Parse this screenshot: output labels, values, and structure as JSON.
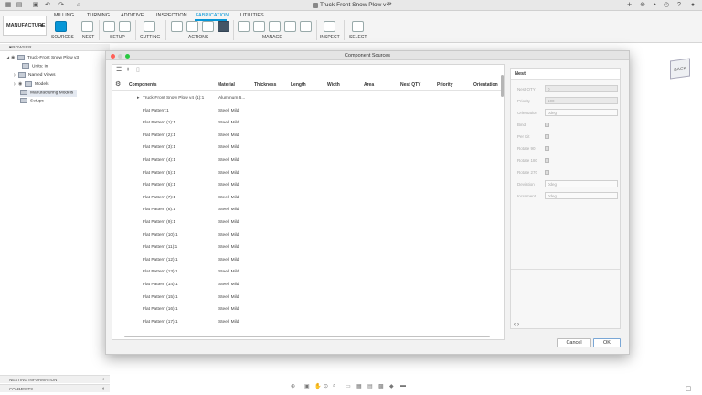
{
  "window": {
    "document_title": "Truck-Front Snow Plow v4*"
  },
  "ribbon": {
    "workspace": "MANUFACTURE",
    "tabs": [
      "MILLING",
      "TURNING",
      "ADDITIVE",
      "INSPECTION",
      "FABRICATION",
      "UTILITIES"
    ],
    "active_tab": "FABRICATION",
    "groups": [
      "SOURCES",
      "NEST",
      "SETUP",
      "CUTTING",
      "ACTIONS",
      "MANAGE",
      "INSPECT",
      "SELECT"
    ]
  },
  "browser": {
    "header": "BROWSER",
    "items": [
      {
        "label": "Truck-Front Snow Plow v3"
      },
      {
        "label": "Units: in"
      },
      {
        "label": "Named Views"
      },
      {
        "label": "Models"
      },
      {
        "label": "Manufacturing Models"
      },
      {
        "label": "Setups"
      }
    ]
  },
  "bottom_panels": {
    "nesting_information": "NESTING INFORMATION",
    "comments": "COMMENTS"
  },
  "viewcube": {
    "face": "BACK"
  },
  "dialog": {
    "title": "Component Sources",
    "columns": [
      "Components",
      "Material",
      "Thickness",
      "Length",
      "Width",
      "Area",
      "Nest QTY",
      "Priority",
      "Orientation"
    ],
    "rows": [
      {
        "component": "Truck-Front Snow Plow v4 (1):1",
        "material": "Aluminum 6..."
      },
      {
        "component": "Flat Pattern:1",
        "material": "Steel, Mild"
      },
      {
        "component": "Flat Pattern (1):1",
        "material": "Steel, Mild"
      },
      {
        "component": "Flat Pattern (2):1",
        "material": "Steel, Mild"
      },
      {
        "component": "Flat Pattern (3):1",
        "material": "Steel, Mild"
      },
      {
        "component": "Flat Pattern (4):1",
        "material": "Steel, Mild"
      },
      {
        "component": "Flat Pattern (5):1",
        "material": "Steel, Mild"
      },
      {
        "component": "Flat Pattern (6):1",
        "material": "Steel, Mild"
      },
      {
        "component": "Flat Pattern (7):1",
        "material": "Steel, Mild"
      },
      {
        "component": "Flat Pattern (8):1",
        "material": "Steel, Mild"
      },
      {
        "component": "Flat Pattern (9):1",
        "material": "Steel, Mild"
      },
      {
        "component": "Flat Pattern (10):1",
        "material": "Steel, Mild"
      },
      {
        "component": "Flat Pattern (11):1",
        "material": "Steel, Mild"
      },
      {
        "component": "Flat Pattern (12):1",
        "material": "Steel, Mild"
      },
      {
        "component": "Flat Pattern (13):1",
        "material": "Steel, Mild"
      },
      {
        "component": "Flat Pattern (14):1",
        "material": "Steel, Mild"
      },
      {
        "component": "Flat Pattern (15):1",
        "material": "Steel, Mild"
      },
      {
        "component": "Flat Pattern (16):1",
        "material": "Steel, Mild"
      },
      {
        "component": "Flat Pattern (17):1",
        "material": "Steel, Mild"
      }
    ],
    "props": {
      "header": "Nest",
      "nest_qty_label": "Nest QTY",
      "nest_qty_value": "0",
      "priority_label": "Priority",
      "priority_value": "100",
      "orientation_label": "Orientation",
      "orientation_value": "0deg",
      "bind_label": "Bind",
      "per_kit_label": "Per Kit",
      "rotate_90_label": "Rotate 90",
      "rotate_180_label": "Rotate 180",
      "rotate_270_label": "Rotate 270",
      "deviation_label": "Deviation",
      "deviation_value": "0deg",
      "increment_label": "Increment",
      "increment_value": "0deg"
    },
    "cancel_label": "Cancel",
    "ok_label": "OK"
  }
}
